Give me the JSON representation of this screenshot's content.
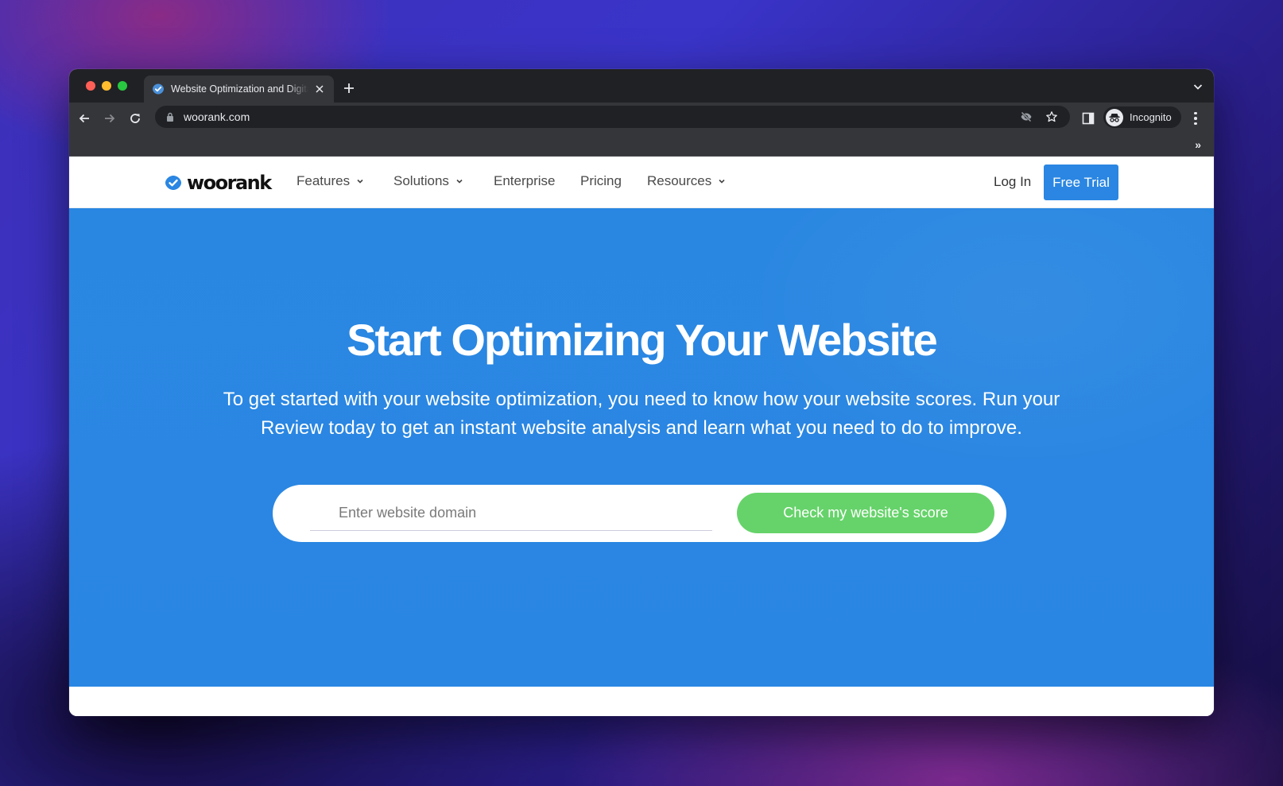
{
  "browser": {
    "traffic_lights": {
      "close": "#ff5f57",
      "minimize": "#febc2e",
      "maximize": "#28c840"
    },
    "tab": {
      "title": "Website Optimization and Digital Marketing Tools",
      "favicon": "woorank-check-icon",
      "close_icon": "close-icon"
    },
    "new_tab_icon": "plus-icon",
    "tab_search_icon": "chevron-down-icon",
    "toolbar": {
      "back_icon": "arrow-left-icon",
      "forward_icon": "arrow-right-icon",
      "reload_icon": "reload-icon",
      "url": "woorank.com",
      "lock_icon": "lock-icon",
      "tracking_icon": "eye-off-icon",
      "bookmark_icon": "star-icon",
      "side_panel_icon": "side-panel-icon",
      "profile_label": "Incognito",
      "menu_icon": "more-vertical-icon"
    },
    "bookmarks_overflow": "»"
  },
  "site": {
    "brand": "woorank",
    "nav": {
      "items": [
        {
          "label": "Features",
          "has_dropdown": true
        },
        {
          "label": "Solutions",
          "has_dropdown": true
        },
        {
          "label": "Enterprise",
          "has_dropdown": false
        },
        {
          "label": "Pricing",
          "has_dropdown": false
        },
        {
          "label": "Resources",
          "has_dropdown": true
        }
      ],
      "login": "Log In",
      "cta": "Free Trial"
    },
    "hero": {
      "title": "Start Optimizing Your Website",
      "subtitle": "To get started with your website optimization, you need to know how your website scores. Run your Review today to get an instant website analysis and learn what you need to do to improve.",
      "input_placeholder": "Enter website domain",
      "input_value": "",
      "button": "Check my website's score"
    },
    "colors": {
      "brand_blue": "#2a86e2",
      "cta_green": "#66d36a"
    }
  }
}
